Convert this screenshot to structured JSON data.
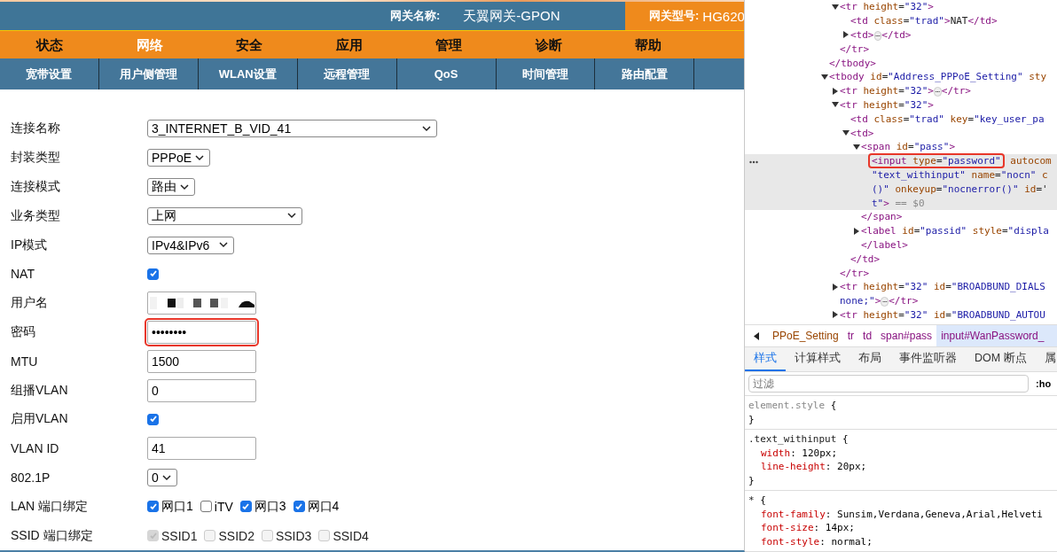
{
  "header": {
    "name_label": "网关名称:",
    "name_value": "天翼网关-GPON",
    "model_label": "网关型号:",
    "model_value": "HG620"
  },
  "menu": [
    {
      "label": "状态",
      "selected": false
    },
    {
      "label": "网络",
      "selected": true
    },
    {
      "label": "安全",
      "selected": false
    },
    {
      "label": "应用",
      "selected": false
    },
    {
      "label": "管理",
      "selected": false
    },
    {
      "label": "诊断",
      "selected": false
    },
    {
      "label": "帮助",
      "selected": false
    }
  ],
  "submenu": [
    {
      "label": "宽带设置"
    },
    {
      "label": "用户侧管理"
    },
    {
      "label": "WLAN设置"
    },
    {
      "label": "远程管理"
    },
    {
      "label": "QoS"
    },
    {
      "label": "时间管理"
    },
    {
      "label": "路由配置"
    }
  ],
  "form": [
    {
      "label": "连接名称",
      "kind": "select",
      "value": "3_INTERNET_B_VID_41"
    },
    {
      "label": "封装类型",
      "kind": "select",
      "value": "PPPoE"
    },
    {
      "label": "连接模式",
      "kind": "select",
      "value": "路由"
    },
    {
      "label": "业务类型",
      "kind": "select",
      "value": "上网"
    },
    {
      "label": "IP模式",
      "kind": "select",
      "value": "IPv4&IPv6"
    },
    {
      "label": "NAT",
      "kind": "checkbox",
      "checked": true
    },
    {
      "label": "用户名",
      "kind": "redacted"
    },
    {
      "label": "密码",
      "kind": "password",
      "value": "••••••••",
      "highlighted": true
    },
    {
      "label": "MTU",
      "kind": "text",
      "value": "1500"
    },
    {
      "label": "组播VLAN",
      "kind": "text",
      "value": "0"
    },
    {
      "label": "启用VLAN",
      "kind": "checkbox",
      "checked": true
    },
    {
      "label": "VLAN ID",
      "kind": "text",
      "value": "41"
    },
    {
      "label": "802.1P",
      "kind": "select",
      "value": "0"
    },
    {
      "label": "LAN 端口绑定",
      "kind": "checkgroup",
      "options": [
        {
          "label": "网口1",
          "checked": true,
          "disabled": false
        },
        {
          "label": "iTV",
          "checked": false,
          "disabled": false
        },
        {
          "label": "网口3",
          "checked": true,
          "disabled": false
        },
        {
          "label": "网口4",
          "checked": true,
          "disabled": false
        }
      ]
    },
    {
      "label": "SSID 端口绑定",
      "kind": "checkgroup",
      "options": [
        {
          "label": "SSID1",
          "checked": true,
          "disabled": true
        },
        {
          "label": "SSID2",
          "checked": false,
          "disabled": true
        },
        {
          "label": "SSID3",
          "checked": false,
          "disabled": true
        },
        {
          "label": "SSID4",
          "checked": false,
          "disabled": true
        }
      ]
    }
  ],
  "elements": [
    {
      "close": [
        [
          {
            "t": "</tbody>",
            "kind": "tag"
          }
        ]
      ],
      "children": [
        {
          "lines": [
            [
              {
                "t": "<tr",
                "kind": "tag"
              },
              {
                "t": " height",
                "kind": "attr"
              },
              {
                "t": "=",
                "kind": "eq"
              },
              {
                "t": "\"32\"",
                "kind": "val"
              },
              {
                "t": ">",
                "kind": "tag"
              }
            ]
          ],
          "expanded": true,
          "selected": false,
          "close": [
            [
              {
                "t": "</tr>",
                "kind": "tag"
              }
            ]
          ],
          "children": [
            {
              "lines": [
                [
                  {
                    "t": "<td",
                    "kind": "tag"
                  },
                  {
                    "t": " class",
                    "kind": "attr"
                  },
                  {
                    "t": "=",
                    "kind": "eq"
                  },
                  {
                    "t": "\"trad\"",
                    "kind": "val"
                  },
                  {
                    "t": ">",
                    "kind": "tag"
                  },
                  {
                    "t": "NAT",
                    "kind": "text"
                  },
                  {
                    "t": "</td>",
                    "kind": "tag"
                  }
                ]
              ],
              "selected": false
            },
            {
              "lines": [
                [
                  {
                    "t": "<td>",
                    "kind": "tag"
                  },
                  {
                    "t": "⋯",
                    "kind": "more"
                  },
                  {
                    "t": "</td>",
                    "kind": "tag"
                  }
                ]
              ],
              "expanded": false,
              "selected": false
            }
          ]
        }
      ]
    },
    {
      "lines": [
        [
          {
            "t": "<tbody",
            "kind": "tag"
          },
          {
            "t": " id",
            "kind": "attr"
          },
          {
            "t": "=",
            "kind": "eq"
          },
          {
            "t": "\"Address_PPPoE_Setting\"",
            "kind": "val"
          },
          {
            "t": " sty",
            "kind": "attr"
          }
        ]
      ],
      "expanded": true,
      "selected": false,
      "children": [
        {
          "lines": [
            [
              {
                "t": "<tr",
                "kind": "tag"
              },
              {
                "t": " height",
                "kind": "attr"
              },
              {
                "t": "=",
                "kind": "eq"
              },
              {
                "t": "\"32\"",
                "kind": "val"
              },
              {
                "t": ">",
                "kind": "tag"
              },
              {
                "t": "⋯",
                "kind": "more"
              },
              {
                "t": "</tr>",
                "kind": "tag"
              }
            ]
          ],
          "expanded": false,
          "selected": false
        },
        {
          "lines": [
            [
              {
                "t": "<tr",
                "kind": "tag"
              },
              {
                "t": " height",
                "kind": "attr"
              },
              {
                "t": "=",
                "kind": "eq"
              },
              {
                "t": "\"32\"",
                "kind": "val"
              },
              {
                "t": ">",
                "kind": "tag"
              }
            ]
          ],
          "expanded": true,
          "selected": false,
          "close": [
            [
              {
                "t": "</tr>",
                "kind": "tag"
              }
            ]
          ],
          "children": [
            {
              "lines": [
                [
                  {
                    "t": "<td",
                    "kind": "tag"
                  },
                  {
                    "t": " class",
                    "kind": "attr"
                  },
                  {
                    "t": "=",
                    "kind": "eq"
                  },
                  {
                    "t": "\"trad\"",
                    "kind": "val"
                  },
                  {
                    "t": " key",
                    "kind": "attr"
                  },
                  {
                    "t": "=",
                    "kind": "eq"
                  },
                  {
                    "t": "\"key_user_pa",
                    "kind": "val"
                  }
                ]
              ],
              "selected": false
            },
            {
              "lines": [
                [
                  {
                    "t": "<td>",
                    "kind": "tag"
                  }
                ]
              ],
              "expanded": true,
              "selected": false,
              "close": [
                [
                  {
                    "t": "</td>",
                    "kind": "tag"
                  }
                ]
              ],
              "children": [
                {
                  "lines": [
                    [
                      {
                        "t": "<span",
                        "kind": "tag"
                      },
                      {
                        "t": " id",
                        "kind": "attr"
                      },
                      {
                        "t": "=",
                        "kind": "eq"
                      },
                      {
                        "t": "\"pass\"",
                        "kind": "val"
                      },
                      {
                        "t": ">",
                        "kind": "tag"
                      }
                    ]
                  ],
                  "expanded": true,
                  "selected": false,
                  "close": [
                    [
                      {
                        "t": "</span>",
                        "kind": "tag"
                      }
                    ]
                  ],
                  "children": [
                    {
                      "lines": [
                        [
                          {
                            "t": "<input",
                            "kind": "tag",
                            "boxed": true
                          },
                          {
                            "t": " type",
                            "kind": "attr",
                            "boxed": true
                          },
                          {
                            "t": "=",
                            "kind": "eq",
                            "boxed": true
                          },
                          {
                            "t": "\"password\"",
                            "kind": "val",
                            "boxed": true
                          },
                          {
                            "t": " autocom",
                            "kind": "attr"
                          }
                        ],
                        [
                          {
                            "t": "\"text_withinput\"",
                            "kind": "val"
                          },
                          {
                            "t": " name",
                            "kind": "attr"
                          },
                          {
                            "t": "=",
                            "kind": "eq"
                          },
                          {
                            "t": "\"nocn\"",
                            "kind": "val"
                          },
                          {
                            "t": " c",
                            "kind": "attr"
                          }
                        ],
                        [
                          {
                            "t": "()\"",
                            "kind": "val"
                          },
                          {
                            "t": " onkeyup",
                            "kind": "attr"
                          },
                          {
                            "t": "=",
                            "kind": "eq"
                          },
                          {
                            "t": "\"nocnerror()\"",
                            "kind": "val"
                          },
                          {
                            "t": " id",
                            "kind": "attr"
                          },
                          {
                            "t": "='",
                            "kind": "eq"
                          }
                        ],
                        [
                          {
                            "t": "t\"",
                            "kind": "val"
                          },
                          {
                            "t": ">",
                            "kind": "tag"
                          },
                          {
                            "t": " == $0",
                            "kind": "ref"
                          }
                        ]
                      ],
                      "selected": true
                    }
                  ]
                },
                {
                  "lines": [
                    [
                      {
                        "t": "<label",
                        "kind": "tag"
                      },
                      {
                        "t": " id",
                        "kind": "attr"
                      },
                      {
                        "t": "=",
                        "kind": "eq"
                      },
                      {
                        "t": "\"passid\"",
                        "kind": "val"
                      },
                      {
                        "t": " style",
                        "kind": "attr"
                      },
                      {
                        "t": "=",
                        "kind": "eq"
                      },
                      {
                        "t": "\"displa",
                        "kind": "val"
                      }
                    ]
                  ],
                  "expanded": false,
                  "selected": false,
                  "close": [
                    [
                      {
                        "t": "</label>",
                        "kind": "tag"
                      }
                    ]
                  ]
                }
              ]
            }
          ]
        },
        {
          "lines": [
            [
              {
                "t": "<tr",
                "kind": "tag"
              },
              {
                "t": " height",
                "kind": "attr"
              },
              {
                "t": "=",
                "kind": "eq"
              },
              {
                "t": "\"32\"",
                "kind": "val"
              },
              {
                "t": " id",
                "kind": "attr"
              },
              {
                "t": "=",
                "kind": "eq"
              },
              {
                "t": "\"BROADBUND_DIALS",
                "kind": "val"
              }
            ],
            [
              {
                "t": "none;\"",
                "kind": "val"
              },
              {
                "t": ">",
                "kind": "tag"
              },
              {
                "t": "⋯",
                "kind": "more"
              },
              {
                "t": "</tr>",
                "kind": "tag"
              }
            ]
          ],
          "expanded": false,
          "selected": false
        },
        {
          "lines": [
            [
              {
                "t": "<tr",
                "kind": "tag"
              },
              {
                "t": " height",
                "kind": "attr"
              },
              {
                "t": "=",
                "kind": "eq"
              },
              {
                "t": "\"32\"",
                "kind": "val"
              },
              {
                "t": " id",
                "kind": "attr"
              },
              {
                "t": "=",
                "kind": "eq"
              },
              {
                "t": "\"BROADBUND_AUTOU",
                "kind": "val"
              }
            ]
          ],
          "expanded": false,
          "selected": false
        }
      ]
    }
  ],
  "breadcrumb": [
    {
      "label": "PPoE_Setting",
      "kind": "id",
      "selected": false
    },
    {
      "label": "tr",
      "kind": "tag",
      "selected": false
    },
    {
      "label": "td",
      "kind": "tag",
      "selected": false
    },
    {
      "label": "span#pass",
      "kind": "tag",
      "selected": false
    },
    {
      "label": "input#WanPassword_",
      "kind": "tag",
      "selected": true
    }
  ],
  "style_tabs": [
    {
      "label": "样式",
      "selected": true
    },
    {
      "label": "计算样式",
      "selected": false
    },
    {
      "label": "布局",
      "selected": false
    },
    {
      "label": "事件监听器",
      "selected": false
    },
    {
      "label": "DOM 断点",
      "selected": false
    },
    {
      "label": "属",
      "selected": false
    }
  ],
  "filter": {
    "placeholder": "过滤",
    "hov": ":ho"
  },
  "rules": [
    {
      "selector": "element.style",
      "open": " {",
      "close": "}",
      "dim": true
    },
    {
      "selector": ".text_withinput",
      "open": " {",
      "close": "}",
      "dim": false,
      "decls": [
        {
          "prop": "width",
          "value": ": 120px;"
        },
        {
          "prop": "line-height",
          "value": ": 20px;"
        }
      ]
    },
    {
      "selector": "*",
      "open": " {",
      "dim": false,
      "decls": [
        {
          "prop": "font-family",
          "value": ": Sunsim,Verdana,Geneva,Arial,Helveti"
        },
        {
          "prop": "font-size",
          "value": ": 14px;"
        },
        {
          "prop": "font-style",
          "value": ": normal;"
        }
      ]
    }
  ]
}
